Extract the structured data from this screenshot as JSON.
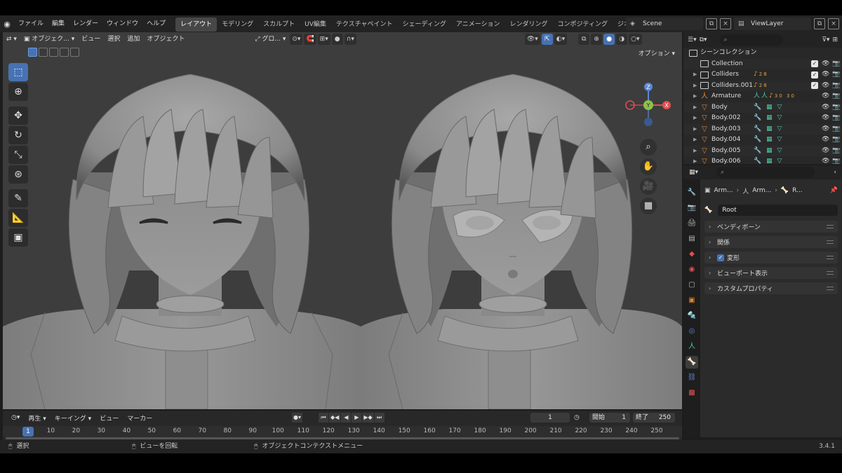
{
  "menu": {
    "items": [
      "ファイル",
      "編集",
      "レンダー",
      "ウィンドウ",
      "ヘルプ"
    ]
  },
  "workspaces": [
    "レイアウト",
    "モデリング",
    "スカルプト",
    "UV編集",
    "テクスチャペイント",
    "シェーディング",
    "アニメーション",
    "レンダリング",
    "コンポジティング",
    "ジオメトリ"
  ],
  "active_workspace": "レイアウト",
  "scene": {
    "label": "Scene",
    "view_layer": "ViewLayer"
  },
  "viewport": {
    "mode": "オブジェク...",
    "menus": [
      "ビュー",
      "選択",
      "追加",
      "オブジェクト"
    ],
    "orientation": "グロ...",
    "options_label": "オプション",
    "gizmo_axes": {
      "z": "Z",
      "y": "Y",
      "x": "X"
    }
  },
  "outliner": {
    "root": "シーンコレクション",
    "rows": [
      {
        "name": "Collection",
        "type": "collection",
        "mods": "",
        "check": true
      },
      {
        "name": "Colliders",
        "type": "collection",
        "mods": "28",
        "check": true
      },
      {
        "name": "Colliders.001",
        "type": "collection",
        "mods": "28",
        "check": true
      },
      {
        "name": "Armature",
        "type": "armature",
        "mods": "30 30",
        "check": false
      },
      {
        "name": "Body",
        "type": "mesh",
        "mods": "",
        "check": false
      },
      {
        "name": "Body.002",
        "type": "mesh",
        "mods": "",
        "check": false
      },
      {
        "name": "Body.003",
        "type": "mesh",
        "mods": "",
        "check": false
      },
      {
        "name": "Body.004",
        "type": "mesh",
        "mods": "",
        "check": false
      },
      {
        "name": "Body.005",
        "type": "mesh",
        "mods": "",
        "check": false
      },
      {
        "name": "Body.006",
        "type": "mesh",
        "mods": "",
        "check": false
      }
    ]
  },
  "properties": {
    "breadcrumb": [
      "Arm...",
      "Arm...",
      "R..."
    ],
    "bone_name": "Root",
    "panels": [
      {
        "label": "ベンディボーン",
        "checkbox": false
      },
      {
        "label": "関係",
        "checkbox": false
      },
      {
        "label": "変形",
        "checkbox": true
      },
      {
        "label": "ビューポート表示",
        "checkbox": false
      },
      {
        "label": "カスタムプロパティ",
        "checkbox": false
      }
    ]
  },
  "timeline": {
    "menus": [
      "再生",
      "キーイング",
      "ビュー",
      "マーカー"
    ],
    "current_frame": "1",
    "start_label": "開始",
    "start": "1",
    "end_label": "終了",
    "end": "250",
    "ticks": [
      "10",
      "20",
      "30",
      "40",
      "50",
      "60",
      "70",
      "80",
      "90",
      "100",
      "110",
      "120",
      "130",
      "140",
      "150",
      "160",
      "170",
      "180",
      "190",
      "200",
      "210",
      "220",
      "230",
      "240",
      "250"
    ]
  },
  "status": {
    "select": "選択",
    "rotate": "ビューを回転",
    "context": "オブジェクトコンテクストメニュー",
    "version": "3.4.1"
  },
  "colors": {
    "accent": "#4772b3",
    "viewport_bg": "#3d3d3d",
    "object_orange": "#e28530"
  }
}
